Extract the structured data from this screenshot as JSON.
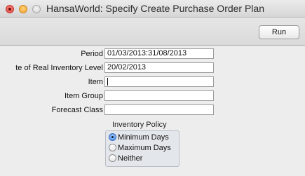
{
  "window": {
    "title": "HansaWorld: Specify Create Purchase Order Plan"
  },
  "toolbar": {
    "run_label": "Run"
  },
  "form": {
    "period": {
      "label": "Period",
      "value": "01/03/2013:31/08/2013"
    },
    "real_inventory_date": {
      "label": "te of Real Inventory Level",
      "value": "20/02/2013"
    },
    "item": {
      "label": "Item",
      "value": ""
    },
    "item_group": {
      "label": "Item Group",
      "value": ""
    },
    "forecast_class": {
      "label": "Forecast Class",
      "value": ""
    }
  },
  "inventory_policy": {
    "title": "Inventory Policy",
    "options": [
      {
        "label": "Minimum Days",
        "selected": true
      },
      {
        "label": "Maximum Days",
        "selected": false
      },
      {
        "label": "Neither",
        "selected": false
      }
    ]
  },
  "colors": {
    "window_bg": "#ececec",
    "radio_selected": "#3d82e0",
    "close_button": "#e0443e",
    "minimize_button": "#f0a12c",
    "zoom_button": "#d4d4d4"
  }
}
